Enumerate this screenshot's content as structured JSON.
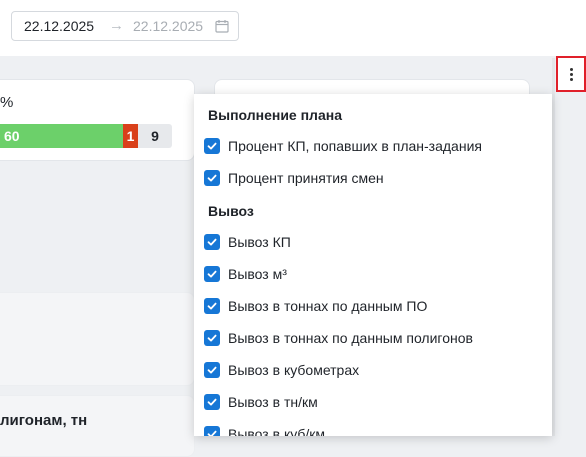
{
  "date_range": {
    "start": "22.12.2025",
    "arrow": "→",
    "end": "22.12.2025"
  },
  "card1": {
    "percent_sign": "%",
    "bar": {
      "green_value": "60",
      "red_value": "1",
      "grey_value": "9"
    }
  },
  "card4": {
    "title": "лигонам, тн"
  },
  "columns_menu": {
    "groups": [
      {
        "title": "Выполнение плана",
        "items": [
          {
            "label": "Процент КП, попавших в план-задания",
            "checked": true
          },
          {
            "label": "Процент принятия смен",
            "checked": true
          }
        ]
      },
      {
        "title": "Вывоз",
        "items": [
          {
            "label": "Вывоз КП",
            "checked": true
          },
          {
            "label": "Вывоз м³",
            "checked": true
          },
          {
            "label": "Вывоз в тоннах по данным ПО",
            "checked": true
          },
          {
            "label": "Вывоз в тоннах по данным полигонов",
            "checked": true
          },
          {
            "label": "Вывоз в кубометрах",
            "checked": true
          },
          {
            "label": "Вывоз в тн/км",
            "checked": true
          },
          {
            "label": "Вывоз в куб/км",
            "checked": true
          }
        ]
      }
    ]
  },
  "colors": {
    "accent": "#1677d6",
    "bar_green": "#6cd06a",
    "bar_red": "#d9401a",
    "highlight": "#e0202a"
  },
  "icons": {
    "calendar": "calendar-icon",
    "more": "more-vertical-icon",
    "check": "check-icon"
  }
}
